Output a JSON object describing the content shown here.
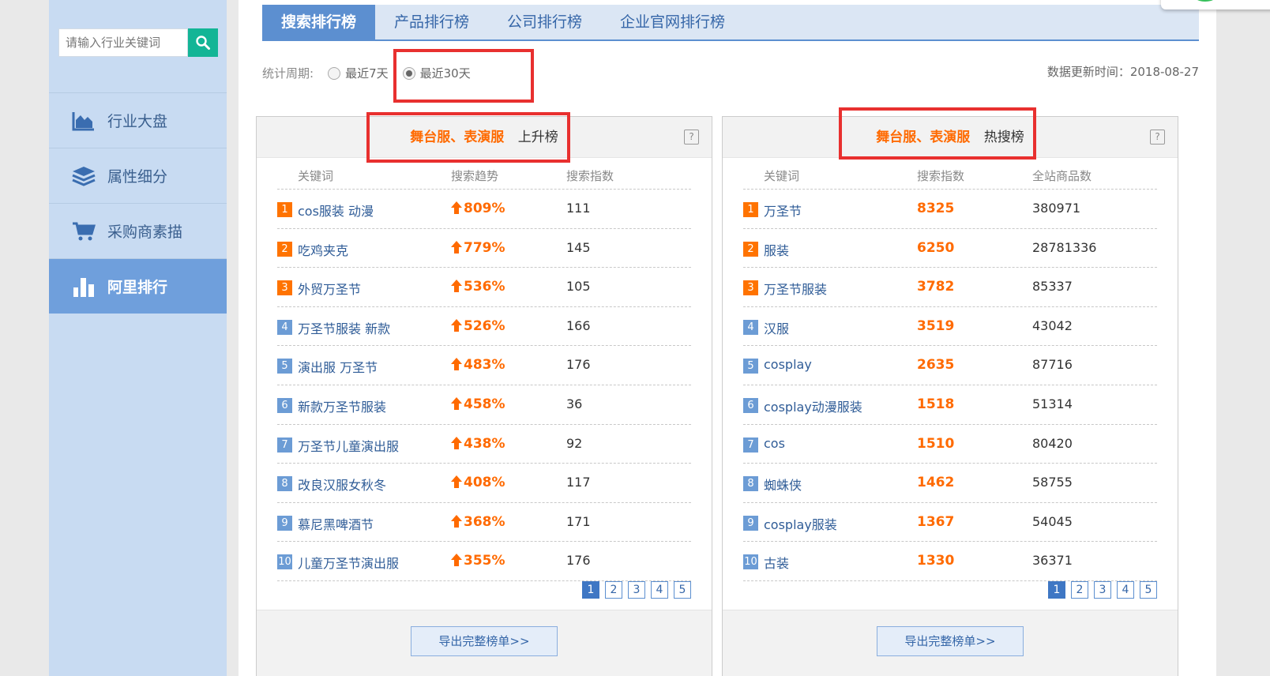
{
  "sidebar": {
    "search_placeholder": "请输入行业关键词",
    "nav": [
      {
        "label": "行业大盘",
        "icon": "area-chart-icon",
        "active": false
      },
      {
        "label": "属性细分",
        "icon": "layers-icon",
        "active": false
      },
      {
        "label": "采购商素描",
        "icon": "shopping-cart-icon",
        "active": false
      },
      {
        "label": "阿里排行",
        "icon": "bar-chart-icon",
        "active": true
      }
    ]
  },
  "tabs": [
    "搜索排行榜",
    "产品排行榜",
    "公司排行榜",
    "企业官网排行榜"
  ],
  "period": {
    "label": "统计周期:",
    "options": [
      {
        "label": "最近7天",
        "checked": false
      },
      {
        "label": "最近30天",
        "checked": true
      }
    ]
  },
  "update_time": "数据更新时间：2018-08-27",
  "left_panel": {
    "title_accent": "舞台服、表演服",
    "title_type": "上升榜",
    "help": "?",
    "columns": [
      "关键词",
      "搜索趋势",
      "搜索指数"
    ],
    "rows": [
      {
        "rank": "1",
        "keyword": "cos服装 动漫",
        "trend": "809%",
        "index": "111"
      },
      {
        "rank": "2",
        "keyword": "吃鸡夹克",
        "trend": "779%",
        "index": "145"
      },
      {
        "rank": "3",
        "keyword": "外贸万圣节",
        "trend": "536%",
        "index": "105"
      },
      {
        "rank": "4",
        "keyword": "万圣节服装 新款",
        "trend": "526%",
        "index": "166"
      },
      {
        "rank": "5",
        "keyword": "演出服 万圣节",
        "trend": "483%",
        "index": "176"
      },
      {
        "rank": "6",
        "keyword": "新款万圣节服装",
        "trend": "458%",
        "index": "36"
      },
      {
        "rank": "7",
        "keyword": "万圣节儿童演出服",
        "trend": "438%",
        "index": "92"
      },
      {
        "rank": "8",
        "keyword": "改良汉服女秋冬",
        "trend": "408%",
        "index": "117"
      },
      {
        "rank": "9",
        "keyword": "慕尼黑啤酒节",
        "trend": "368%",
        "index": "171"
      },
      {
        "rank": "10",
        "keyword": "儿童万圣节演出服",
        "trend": "355%",
        "index": "176"
      }
    ],
    "pages": [
      "1",
      "2",
      "3",
      "4",
      "5"
    ],
    "export_label": "导出完整榜单>>"
  },
  "right_panel": {
    "title_accent": "舞台服、表演服",
    "title_type": "热搜榜",
    "help": "?",
    "columns": [
      "关键词",
      "搜索指数",
      "全站商品数"
    ],
    "rows": [
      {
        "rank": "1",
        "keyword": "万圣节",
        "index": "8325",
        "products": "380971"
      },
      {
        "rank": "2",
        "keyword": "服装",
        "index": "6250",
        "products": "28781336"
      },
      {
        "rank": "3",
        "keyword": "万圣节服装",
        "index": "3782",
        "products": "85337"
      },
      {
        "rank": "4",
        "keyword": "汉服",
        "index": "3519",
        "products": "43042"
      },
      {
        "rank": "5",
        "keyword": "cosplay",
        "index": "2635",
        "products": "87716"
      },
      {
        "rank": "6",
        "keyword": "cosplay动漫服装",
        "index": "1518",
        "products": "51314"
      },
      {
        "rank": "7",
        "keyword": "cos",
        "index": "1510",
        "products": "80420"
      },
      {
        "rank": "8",
        "keyword": "蜘蛛侠",
        "index": "1462",
        "products": "58755"
      },
      {
        "rank": "9",
        "keyword": "cosplay服装",
        "index": "1367",
        "products": "54045"
      },
      {
        "rank": "10",
        "keyword": "古装",
        "index": "1330",
        "products": "36371"
      }
    ],
    "pages": [
      "1",
      "2",
      "3",
      "4",
      "5"
    ],
    "export_label": "导出完整榜单>>"
  },
  "colors": {
    "accent": "#ff6a00",
    "primary": "#5c8fd0",
    "sidebar": "#c8dbf2",
    "highlight_box": "#e8302f"
  }
}
